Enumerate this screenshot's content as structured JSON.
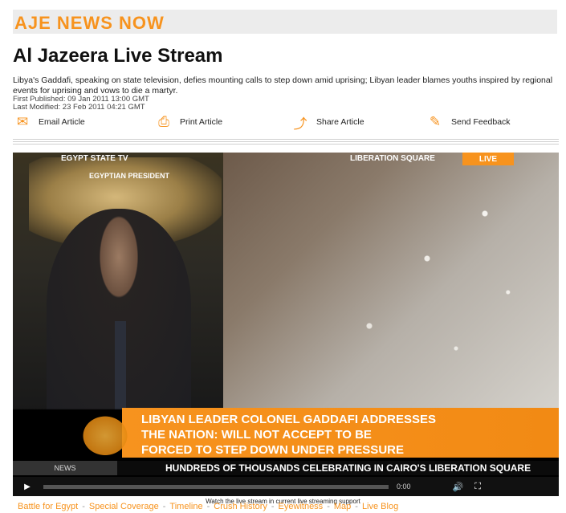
{
  "header": {
    "brand": "AJE NEWS NOW"
  },
  "article": {
    "title": "Al Jazeera Live Stream",
    "summary": "Libya's Gaddafi, speaking on state television, defies mounting calls to step down amid uprising; Libyan leader blames youths inspired by regional events for uprising and vows to die a martyr.",
    "first_published": "First Published: 09 Jan 2011 13:00 GMT",
    "last_modified": "Last Modified: 23 Feb 2011 04:21 GMT"
  },
  "actions": [
    {
      "label": "Email Article",
      "icon": "envelope-icon"
    },
    {
      "label": "Print Article",
      "icon": "printer-icon"
    },
    {
      "label": "Share Article",
      "icon": "share-icon"
    },
    {
      "label": "Send Feedback",
      "icon": "feedback-icon"
    }
  ],
  "video": {
    "left_label": "EGYPT STATE TV",
    "left_sublabel": "EGYPTIAN PRESIDENT",
    "right_label": "LIBERATION SQUARE",
    "live_badge": "LIVE",
    "ticker_lines": [
      "LIBYAN LEADER COLONEL GADDAFI ADDRESSES",
      "THE NATION: WILL NOT ACCEPT TO BE",
      "FORCED TO STEP DOWN UNDER PRESSURE"
    ],
    "crawl_tag": "NEWS",
    "crawl_text": "HUNDREDS OF THOUSANDS CELEBRATING IN CAIRO'S LIBERATION SQUARE",
    "time_display": "0:00",
    "progress_fraction": 0
  },
  "caption": "Watch the live stream in current live streaming support",
  "footer_links": [
    "Battle for Egypt",
    "Special Coverage",
    "Timeline",
    "Crush History",
    "Eyewitness",
    "Map",
    "Live Blog"
  ],
  "colors": {
    "accent": "#f7931e"
  }
}
